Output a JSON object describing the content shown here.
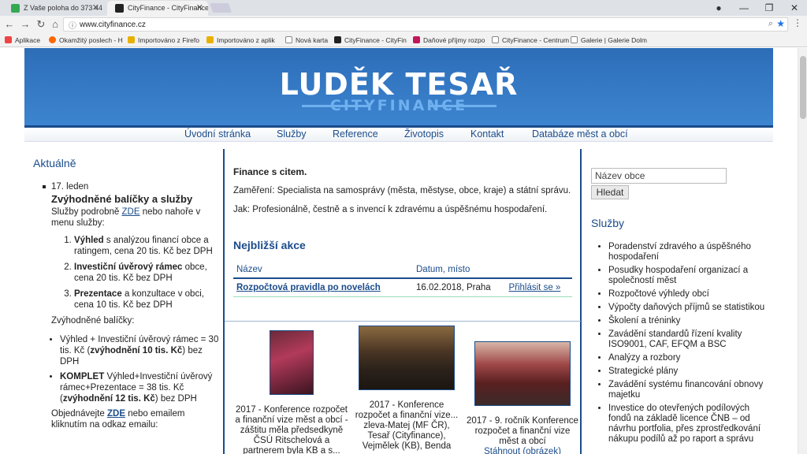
{
  "browser": {
    "tabs": [
      {
        "title": "Z Vaše poloha do 373 44",
        "fav_color": "#34a853"
      },
      {
        "title": "CityFinance - CityFinance",
        "fav_color": "#222222"
      }
    ],
    "url": "www.cityfinance.cz",
    "bookmarks": [
      {
        "label": "Aplikace",
        "color": "#e44"
      },
      {
        "label": "Okamžitý poslech - H",
        "color": "#f60"
      },
      {
        "label": "Importováno z Firefo",
        "color": "#e8b100"
      },
      {
        "label": "Importováno z aplik",
        "color": "#e8b100"
      },
      {
        "label": "Nová karta",
        "color": "#888"
      },
      {
        "label": "CityFinance - CityFin",
        "color": "#222"
      },
      {
        "label": "Daňové příjmy rozpo",
        "color": "#c2185b"
      },
      {
        "label": "CityFinance - Centrum",
        "color": "#888"
      },
      {
        "label": "Galerie | Galerie Dolm",
        "color": "#888"
      }
    ]
  },
  "site": {
    "logo_name": "LUDĚK TESAŘ",
    "logo_sub": "CITYFINANCE",
    "nav": [
      "Úvodní stránka",
      "Služby",
      "Reference",
      "Životopis",
      "Kontakt",
      "Databáze měst a obcí"
    ]
  },
  "left": {
    "title": "Aktuálně",
    "date": "17. leden",
    "headline": "Zvýhodněné balíčky a služby",
    "intro_pre": "Služby podrobně",
    "intro_link": "ZDE",
    "intro_post": "nebo nahoře v menu služby:",
    "offers": [
      {
        "bold": "Výhled",
        "rest": "s analýzou financí obce a ratingem, cena 20 tis. Kč bez DPH"
      },
      {
        "bold": "Investiční úvěrový rámec",
        "rest": "obce, cena 20 tis. Kč bez DPH"
      },
      {
        "bold": "Prezentace",
        "rest": "a konzultace v obci, cena 10 tis. Kč bez DPH"
      }
    ],
    "packages_title": "Zvýhodněné balíčky:",
    "packages": [
      {
        "pre": "Výhled + Investiční úvěrový rámec = 30 tis. Kč (",
        "bold": "zvýhodnění 10 tis. Kč",
        "post": ") bez DPH"
      },
      {
        "pre_bold": "KOMPLET",
        "pre": "Výhled+Investiční úvěrový rámec+Prezentace = 38 tis. Kč (",
        "bold": "zvýhodnění 12 tis. Kč",
        "post": ") bez DPH"
      }
    ],
    "contact_pre": "Objednávejte",
    "contact_link": "ZDE",
    "contact_post": "nebo emailem kliknutím na odkaz emailu:"
  },
  "center": {
    "heading": "Finance s citem.",
    "line1": "Zaměření: Specialista na samosprávy (města, městyse, obce, kraje) a státní správu.",
    "line2": "Jak: Profesionálně, čestně a s invencí k zdravému a úspěšnému hospodaření.",
    "events_title": "Nejbližší akce",
    "events_headers": [
      "Název",
      "Datum, místo"
    ],
    "events_rows": [
      {
        "name": "Rozpočtová pravidla po novelách",
        "date": "16.02.2018, Praha",
        "action": "Přihlásit se »"
      }
    ],
    "gallery": [
      {
        "caption": "2017 - Konference rozpočet a finanční vize měst a obcí - záštitu měla předsedkyně ČSÚ Ritschelová a partnerem byla KB a s..."
      },
      {
        "caption": "2017 - Konference rozpočet a finanční vize... zleva-Matej (MF ČR), Tesař (Cityfinance), Vejmělek (KB), Benda"
      },
      {
        "caption": "2017 - 9. ročník Konference rozpočet a finanční vize měst a obcí",
        "link": "Stáhnout (obrázek)"
      }
    ]
  },
  "right": {
    "search_placeholder": "Název obce",
    "search_button": "Hledat",
    "services_title": "Služby",
    "services": [
      "Poradenství zdravého a úspěšného hospodaření",
      "Posudky hospodaření organizací a společností měst",
      "Rozpočtové výhledy obcí",
      "Výpočty daňových příjmů se statistikou",
      "Školení a tréninky",
      "Zavádění standardů řízení kvality ISO9001, CAF, EFQM a BSC",
      "Analýzy a rozbory",
      "Strategické plány",
      "Zavádění systému financování obnovy majetku",
      "Investice do otevřených podílových fondů na základě licence ČNB – od návrhu portfolia, přes zprostředkování nákupu podílů až po raport a správu"
    ]
  }
}
